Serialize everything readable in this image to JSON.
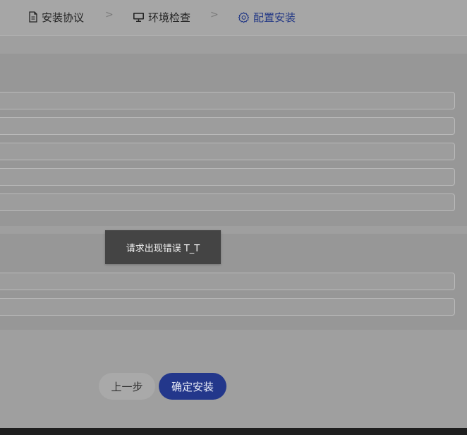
{
  "steps": [
    {
      "label": "安装协议",
      "icon": "document-icon",
      "active": false
    },
    {
      "label": "环境检查",
      "icon": "monitor-icon",
      "active": false
    },
    {
      "label": "配置安装",
      "icon": "gear-icon",
      "active": true
    }
  ],
  "step_separator": ">",
  "toast": {
    "message": "请求出现错误 T_T"
  },
  "buttons": {
    "prev_label": "上一步",
    "confirm_label": "确定安装"
  },
  "colors": {
    "accent": "#23378b",
    "active_step": "#253a86",
    "toast_bg": "#444444"
  }
}
